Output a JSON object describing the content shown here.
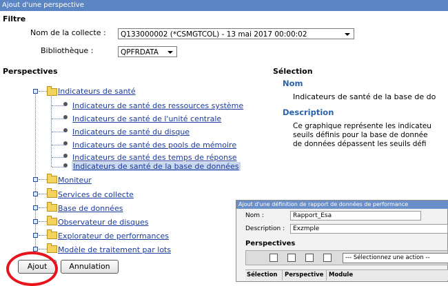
{
  "window": {
    "title": "Ajout d'une perspective"
  },
  "filter": {
    "heading": "Filtre",
    "collection_label": "Nom de la collecte :",
    "collection_value": "Q133000002 (*CSMGTCOL) - 13 mai 2017 00:00:02",
    "library_label": "Bibliothèque :",
    "library_value": "QPFRDATA"
  },
  "perspectives": {
    "heading": "Perspectives",
    "root": "Indicateurs de santé",
    "children": [
      "Indicateurs de santé des ressources système",
      "Indicateurs de santé de l'unité centrale",
      "Indicateurs de santé du disque",
      "Indicateurs de santé des pools de mémoire",
      "Indicateurs de santé des temps de réponse",
      "Indicateurs de santé de la base de données"
    ],
    "folders": [
      "Moniteur",
      "Services de collecte",
      "Base de données",
      "Observateur de disques",
      "Explorateur de performances",
      "Modèle de traitement par lots"
    ]
  },
  "selection": {
    "heading": "Sélection",
    "name_heading": "Nom",
    "name_value": "Indicateurs de santé de la base de do",
    "description_heading": "Description",
    "description_lines": [
      "Ce graphique représente les indicateu",
      "seuils définis pour la base de donnée",
      "de données dépassent les seuils défi"
    ]
  },
  "buttons": {
    "add": "Ajout",
    "cancel": "Annulation"
  },
  "dialog": {
    "title": "Ajout d'une définition de rapport de données de performance",
    "name_label": "Nom :",
    "name_value": "Rapport_Esa",
    "description_label": "Description :",
    "description_value": "Exzmple",
    "perspectives_heading": "Perspectives",
    "action_select": "--- Sélectionnez une action --",
    "columns": [
      "Sélection",
      "Perspective",
      "Module"
    ]
  },
  "colors": {
    "title_bar": "#5b86c3",
    "link": "#1a3a9c",
    "highlight_circle": "#e8141c"
  }
}
